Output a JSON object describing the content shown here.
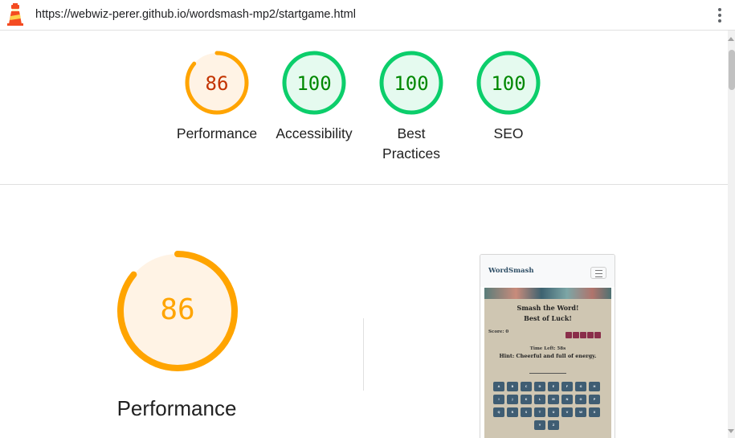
{
  "browser": {
    "url": "https://webwiz-perer.github.io/wordsmash-mp2/startgame.html",
    "logo_icon": "lighthouse-icon",
    "menu_icon": "vertical-dots-icon"
  },
  "summary_scores": [
    {
      "label": "Performance",
      "score": 86,
      "status_color": "#ffa400",
      "text_color": "#c33300",
      "fill_color": "#fff3e5"
    },
    {
      "label": "Accessibility",
      "score": 100,
      "status_color": "#0cce6b",
      "text_color": "#008800",
      "fill_color": "#e5faef"
    },
    {
      "label": "Best\nPractices",
      "score": 100,
      "status_color": "#0cce6b",
      "text_color": "#008800",
      "fill_color": "#e5faef"
    },
    {
      "label": "SEO",
      "score": 100,
      "status_color": "#0cce6b",
      "text_color": "#008800",
      "fill_color": "#e5faef"
    }
  ],
  "performance": {
    "score": 86,
    "label": "Performance",
    "status_color": "#ffa400",
    "text_color": "#ffa400",
    "fill_color": "#fff3e5"
  },
  "screenshot_preview": {
    "brand": "WordSmash",
    "title_line1": "Smash the Word!",
    "title_line2": "Best of Luck!",
    "score_label": "Score: 0",
    "lives_count": 5,
    "time_left": "Time Left: 58s",
    "hint": "Hint: Cheerful and full of energy.",
    "keys": [
      "A",
      "B",
      "C",
      "D",
      "E",
      "F",
      "G",
      "H",
      "I",
      "J",
      "K",
      "L",
      "M",
      "N",
      "O",
      "P",
      "Q",
      "R",
      "S",
      "T",
      "U",
      "V",
      "W",
      "X",
      "Y",
      "Z"
    ],
    "toggler_icon": "hamburger-menu-icon"
  }
}
